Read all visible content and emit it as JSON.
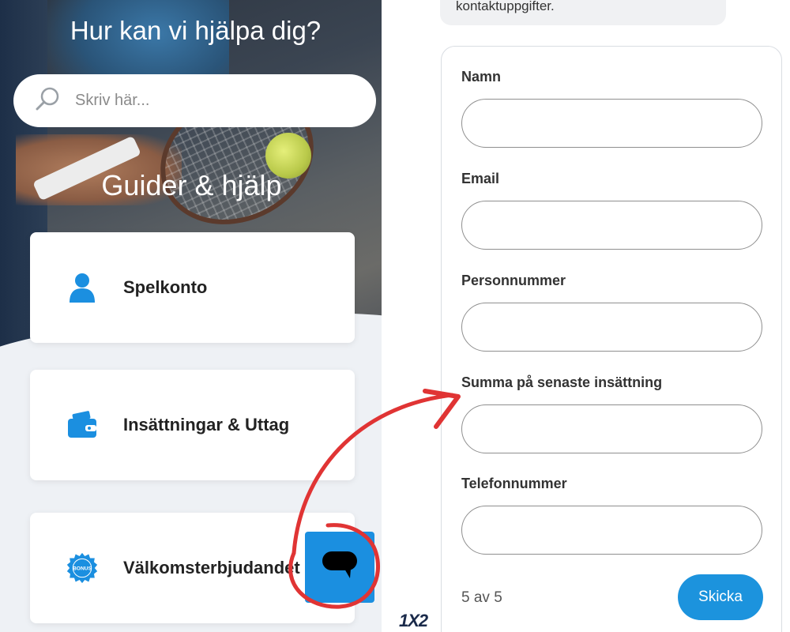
{
  "left": {
    "help_title": "Hur kan vi hjälpa dig?",
    "search_placeholder": "Skriv här...",
    "guides_title": "Guider & hjälp",
    "cards": [
      {
        "label": "Spelkonto",
        "icon": "user-icon"
      },
      {
        "label": "Insättningar & Uttag",
        "icon": "wallet-icon"
      },
      {
        "label": "Välkomsterbjudandet",
        "icon": "bonus-badge-icon",
        "badge_text": "BONUS"
      }
    ],
    "chat_icon": "chat-icon"
  },
  "right": {
    "top_bubble_text": "kontaktuppgifter.",
    "fields": [
      {
        "label": "Namn",
        "value": ""
      },
      {
        "label": "Email",
        "value": ""
      },
      {
        "label": "Personnummer",
        "value": ""
      },
      {
        "label": "Summa på senaste insättning",
        "value": ""
      },
      {
        "label": "Telefonnummer",
        "value": ""
      }
    ],
    "step_text": "5 av 5",
    "submit_label": "Skicka",
    "logo_text": "1X2"
  },
  "colors": {
    "accent": "#1b8fe0",
    "annotation": "#e03434"
  }
}
